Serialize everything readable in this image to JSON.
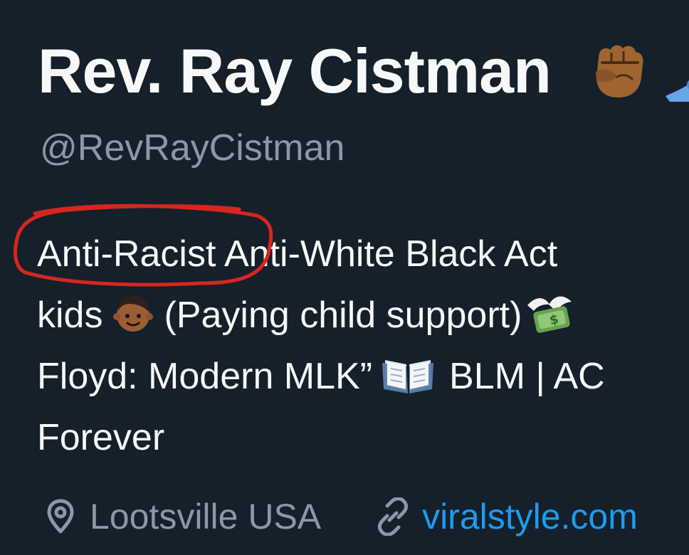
{
  "profile": {
    "display_name": "Rev. Ray Cistman",
    "handle": "@RevRayCistman",
    "bio_lines": [
      {
        "highlighted": "Anti-Racist",
        "rest": " Anti-White Black Act"
      },
      {
        "before": "kids",
        "after": "(Paying child support)"
      },
      {
        "before": "Floyd: Modern MLK”",
        "after": "BLM | AC"
      },
      {
        "text": "Forever"
      }
    ],
    "location": "Lootsville USA",
    "website": "viralstyle.com"
  },
  "emoji_icons": [
    "raised-fist-medium-dark-skin-emoji",
    "boy-medium-dark-skin-emoji",
    "money-with-wings-emoji",
    "open-book-emoji"
  ],
  "annotation": {
    "color": "#d7261e",
    "shape": "hand-drawn-ellipse"
  },
  "colors": {
    "background": "#15202b",
    "primary_text": "#f7f9f9",
    "secondary_text": "#8b98a5",
    "link": "#1d9bf0"
  }
}
